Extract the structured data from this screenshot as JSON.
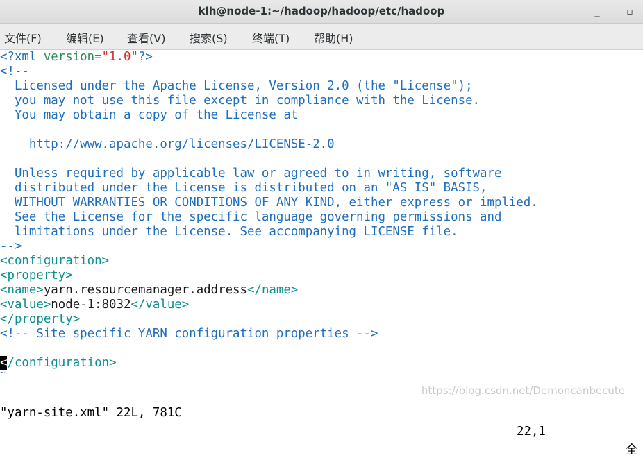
{
  "window": {
    "title": "klh@node-1:~/hadoop/hadoop/etc/hadoop",
    "minimize": "_",
    "maximize": "▫"
  },
  "menubar": {
    "items": [
      "文件(F)",
      "编辑(E)",
      "查看(V)",
      "搜索(S)",
      "终端(T)",
      "帮助(H)"
    ]
  },
  "editor": {
    "xml_open": "<?xml",
    "xml_attr": " version=",
    "xml_value": "\"1.0\"",
    "xml_close": "?>",
    "comment_open": "<!--",
    "license_lines": [
      "  Licensed under the Apache License, Version 2.0 (the \"License\");",
      "  you may not use this file except in compliance with the License.",
      "  You may obtain a copy of the License at",
      "",
      "    http://www.apache.org/licenses/LICENSE-2.0",
      "",
      "  Unless required by applicable law or agreed to in writing, software",
      "  distributed under the License is distributed on an \"AS IS\" BASIS,",
      "  WITHOUT WARRANTIES OR CONDITIONS OF ANY KIND, either express or implied.",
      "  See the License for the specific language governing permissions and",
      "  limitations under the License. See accompanying LICENSE file."
    ],
    "comment_close": "-->",
    "configuration_open": "<configuration>",
    "property_open": "<property>",
    "name_open": "<name>",
    "name_value": "yarn.resourcemanager.address",
    "name_close": "</name>",
    "value_open": "<value>",
    "value_value": "node-1:8032",
    "value_close": "</value>",
    "property_close": "</property>",
    "site_comment": "<!-- Site specific YARN configuration properties -->",
    "blank_line": "",
    "cursor_char": "<",
    "configuration_close_rest": "/configuration>",
    "tilde": "~"
  },
  "statusline": {
    "file_info": "\"yarn-site.xml\" 22L, 781C",
    "position": "22,1",
    "scroll": "全"
  },
  "watermark": "https://blog.csdn.net/Demoncanbecute"
}
